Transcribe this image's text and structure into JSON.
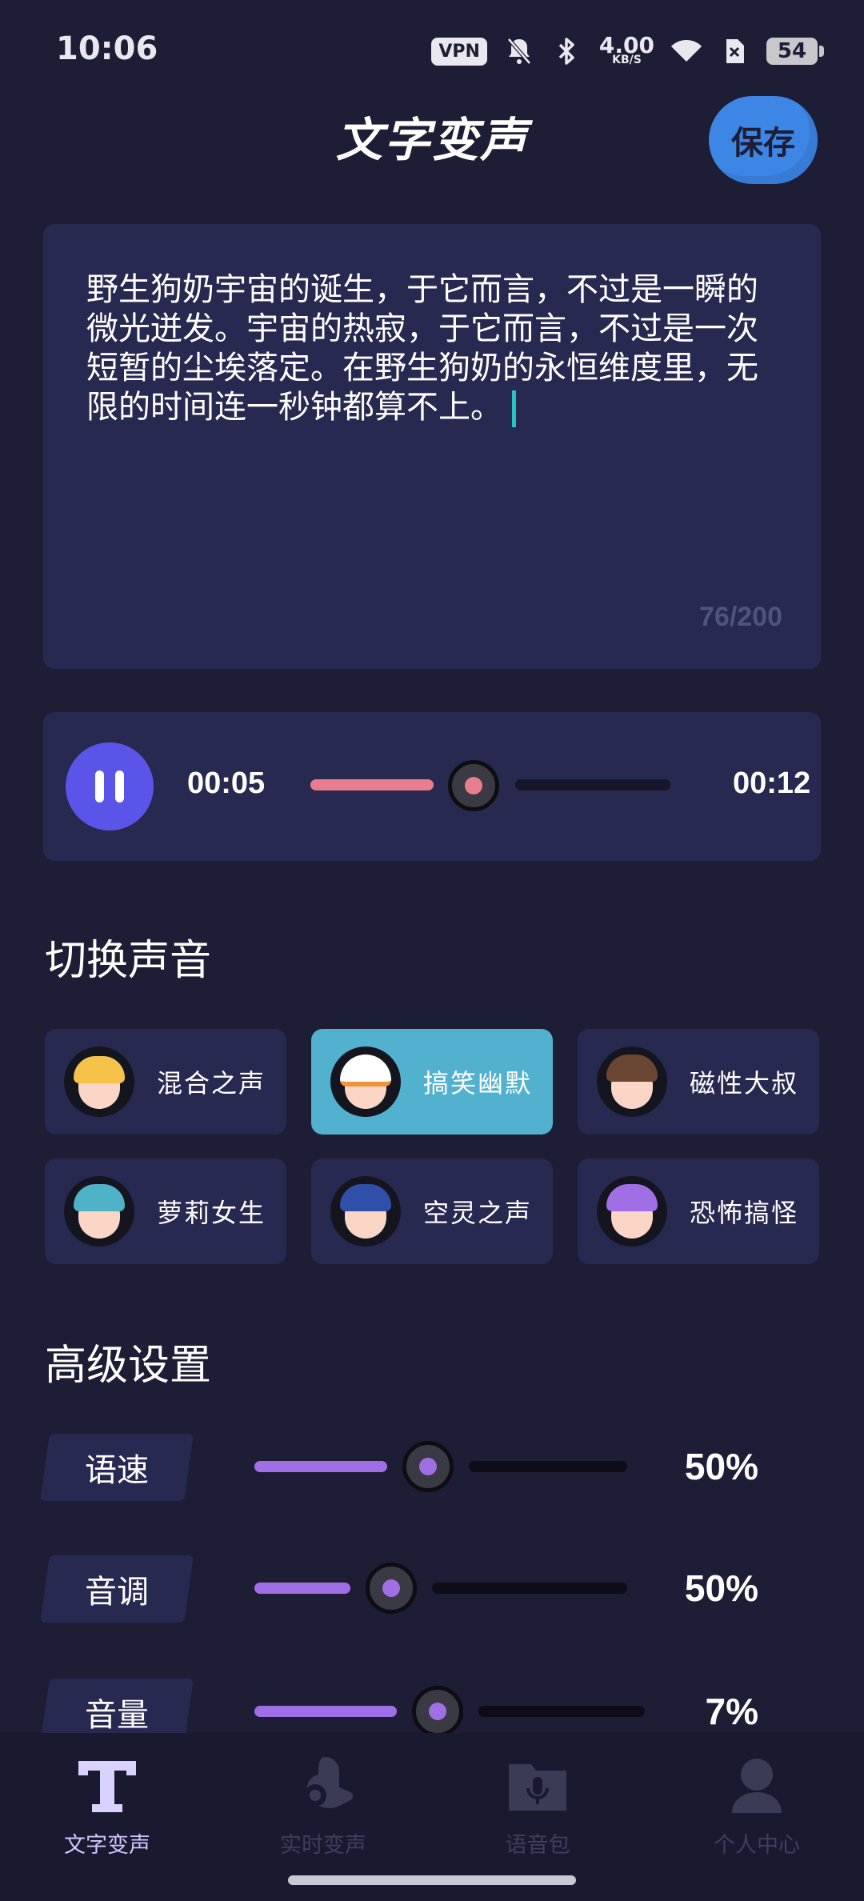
{
  "status_bar": {
    "time": "10:06",
    "vpn": "VPN",
    "net_speed": "4.00",
    "net_unit": "KB/S",
    "battery": "54"
  },
  "header": {
    "title": "文字变声",
    "save_label": "保存"
  },
  "editor": {
    "text": "野生狗奶宇宙的诞生，于它而言，不过是一瞬的微光迸发。宇宙的热寂，于它而言，不过是一次短暂的尘埃落定。在野生狗奶的永恒维度里，无限的时间连一秒钟都算不上。",
    "char_count": "76/200"
  },
  "player": {
    "current_time": "00:05",
    "total_time": "00:12",
    "progress": 0.42
  },
  "voices": {
    "title": "切换声音",
    "items": [
      {
        "label": "混合之声",
        "selected": false
      },
      {
        "label": "搞笑幽默",
        "selected": true
      },
      {
        "label": "磁性大叔",
        "selected": false
      },
      {
        "label": "萝莉女生",
        "selected": false
      },
      {
        "label": "空灵之声",
        "selected": false
      },
      {
        "label": "恐怖搞怪",
        "selected": false
      }
    ]
  },
  "advanced": {
    "title": "高级设置",
    "settings": [
      {
        "label": "语速",
        "value": "50%"
      },
      {
        "label": "音调",
        "value": "50%"
      },
      {
        "label": "音量",
        "value": "7%"
      }
    ]
  },
  "bottom_nav": {
    "items": [
      {
        "label": "文字变声",
        "icon": "text-t-icon",
        "active": true
      },
      {
        "label": "实时变声",
        "icon": "realtime-voice-icon",
        "active": false
      },
      {
        "label": "语音包",
        "icon": "voice-pack-folder-icon",
        "active": false
      },
      {
        "label": "个人中心",
        "icon": "person-icon",
        "active": false
      }
    ]
  },
  "colors": {
    "background": "#1d1d35",
    "card": "#272950",
    "accent_purple": "#5a55e8",
    "slider_purple": "#a06fe6",
    "progress_pink": "#e77d8f",
    "selected_tile": "#52b1cf",
    "save_blue": "#3d86e6"
  }
}
